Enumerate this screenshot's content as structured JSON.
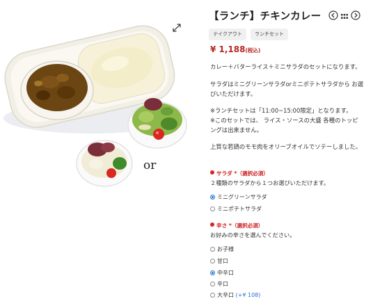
{
  "product": {
    "title": "【ランチ】チキンカレー",
    "tags": [
      "テイクアウト",
      "ランチセット"
    ],
    "price": "¥ 1,188",
    "price_suffix": "(税込)",
    "description": [
      "カレー＋バターライス＋ミニサラダのセットになります。",
      "サラダはミニグリーンサラダorミニポテトサラダから お選",
      "びいただけます。",
      "※ランチセットは「11:00~15:00限定」となります。",
      "※このセットでは、 ライス・ソースの大盛 各種のトッピ",
      "ングは出来ません。",
      "上質な若鶏のモモ肉をオリーブオイルでソテーしました。"
    ]
  },
  "image": {
    "or_text": "or"
  },
  "icons": {
    "expand": "expand-arrows-icon",
    "prev": "chevron-left-circle-icon",
    "grid": "grid-icon",
    "next": "chevron-right-circle-icon"
  },
  "options": {
    "salad": {
      "label": "サラダ *",
      "required": "（選択必須）",
      "hint": "２種類のサラダから１つお選びいただけます。",
      "choices": [
        {
          "label": "ミニグリーンサラダ",
          "selected": true
        },
        {
          "label": "ミニポテトサラダ",
          "selected": false
        }
      ]
    },
    "spice": {
      "label": "辛さ *",
      "required": "（選択必須）",
      "hint": "お好みの辛さを選んでください。",
      "choices": [
        {
          "label": "お子様",
          "selected": false
        },
        {
          "label": "甘口",
          "selected": false
        },
        {
          "label": "中辛口",
          "selected": true
        },
        {
          "label": "辛口",
          "selected": false
        },
        {
          "label": "大辛口",
          "addon": "(+¥ 108)",
          "selected": false
        }
      ]
    }
  },
  "colors": {
    "price": "#b52a24",
    "required": "#cc2222",
    "radio_selected": "#1a6fd8",
    "tag_bg": "#f0f0f0"
  }
}
